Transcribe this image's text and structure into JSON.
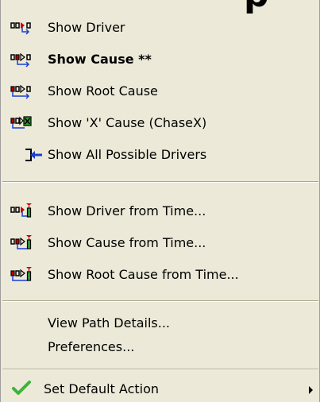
{
  "menu": {
    "items": [
      {
        "label": "Show Driver",
        "icon": "show-driver-icon"
      },
      {
        "label": "Show Cause **",
        "icon": "show-cause-icon",
        "bold": true
      },
      {
        "label": "Show Root Cause",
        "icon": "show-root-cause-icon"
      },
      {
        "label": "Show 'X' Cause (ChaseX)",
        "icon": "show-x-cause-icon"
      },
      {
        "label": "Show All Possible Drivers",
        "icon": "all-drivers-icon"
      },
      {
        "label": "Show Driver from Time...",
        "icon": "driver-from-time-icon"
      },
      {
        "label": "Show Cause from Time...",
        "icon": "cause-from-time-icon"
      },
      {
        "label": "Show Root Cause from Time...",
        "icon": "root-cause-from-time-icon"
      },
      {
        "label": "View Path Details...",
        "icon": ""
      },
      {
        "label": "Preferences...",
        "icon": ""
      },
      {
        "label": "Set Default Action",
        "icon": "checkmark-icon",
        "has_submenu": true
      }
    ]
  },
  "colors": {
    "menu_background": "#ece9d8",
    "signal_red": "#c00000",
    "trace_blue": "#1a3fd6",
    "check_green": "#3cb43c",
    "x_green": "#2e9e2e"
  }
}
